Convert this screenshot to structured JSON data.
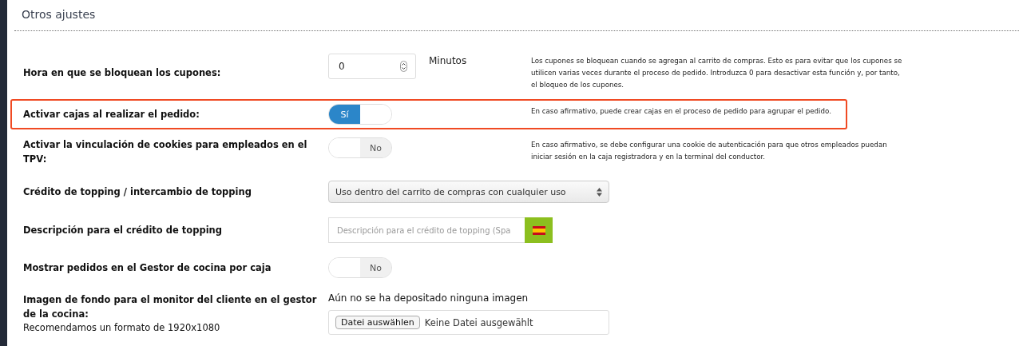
{
  "section_title": "Otros ajustes",
  "rows": [
    {
      "kind": "number",
      "label": "Hora en que se bloquean los cupones:",
      "value": "0",
      "unit": "Minutos",
      "help": "Los cupones se bloquean cuando se agregan al carrito de compras. Esto es para evitar que los cupones se utilicen varias veces durante el proceso de pedido. Introduzca 0 para desactivar esta función y, por tanto, el bloqueo de los cupones.",
      "highlighted": false
    },
    {
      "kind": "toggle",
      "label": "Activar cajas al realizar el pedido:",
      "on": true,
      "toggle_text": "Sí",
      "help": "En caso afirmativo, puede crear cajas en el proceso de pedido para agrupar el pedido.",
      "highlighted": true
    },
    {
      "kind": "toggle",
      "label": "Activar la vinculación de cookies para empleados en el TPV:",
      "on": false,
      "toggle_text": "No",
      "help": "En caso afirmativo, se debe configurar una cookie de autenticación para que otros empleados puedan iniciar sesión en la caja registradora y en la terminal del conductor.",
      "highlighted": false
    },
    {
      "kind": "select",
      "label": "Crédito de topping / intercambio de topping",
      "value": "Uso dentro del carrito de compras con cualquier uso",
      "highlighted": false
    },
    {
      "kind": "text",
      "label": "Descripción para el crédito de topping",
      "placeholder": "Descripción para el crédito de topping (Spa",
      "highlighted": false
    },
    {
      "kind": "toggle",
      "label": "Mostrar pedidos en el Gestor de cocina por caja",
      "on": false,
      "toggle_text": "No",
      "highlighted": false
    },
    {
      "kind": "file",
      "label": "Imagen de fondo para el monitor del cliente en el gestor de la cocina:",
      "sublabel": "Recomendamos un formato de 1920x1080",
      "status": "Aún no se ha depositado ninguna imagen",
      "button": "Datei auswählen",
      "file_text": "Keine Datei ausgewählt",
      "highlighted": false
    }
  ]
}
